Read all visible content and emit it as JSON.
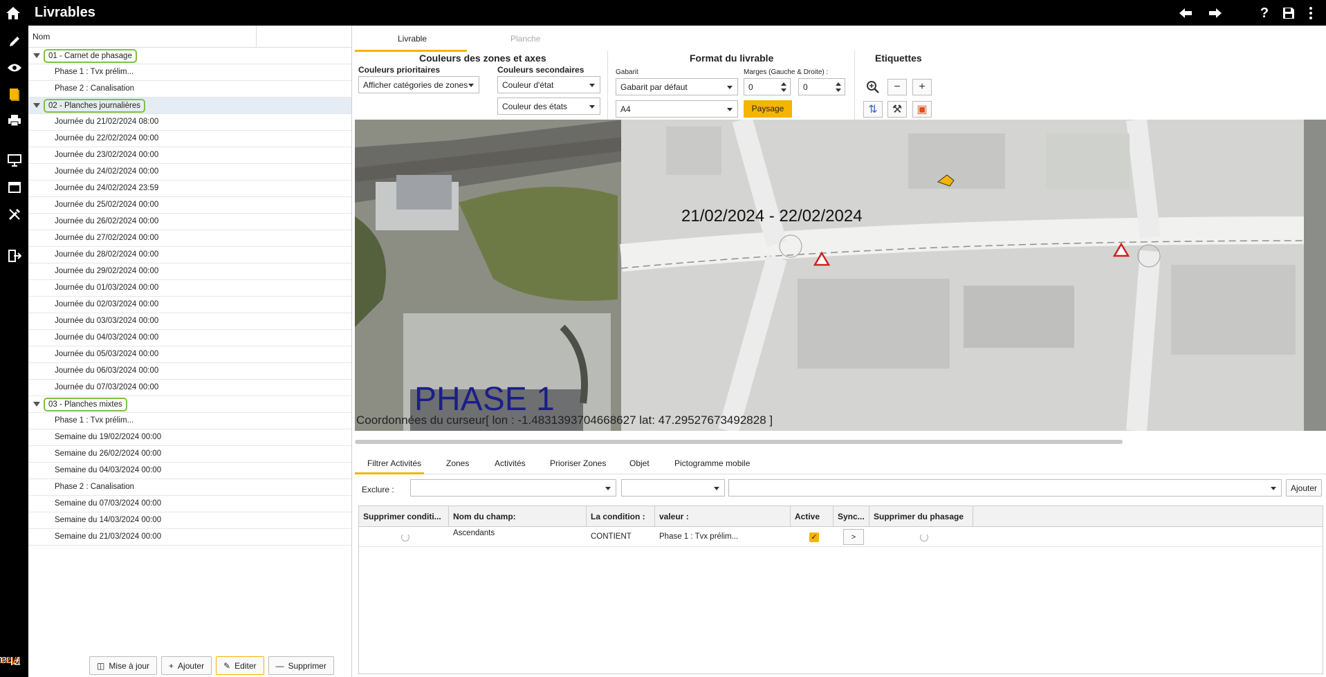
{
  "app": {
    "title": "Livrables",
    "brand": {
      "phase": "Phase",
      "manager": "Manager",
      "version": "7"
    }
  },
  "tree": {
    "header": "Nom",
    "groups": [
      {
        "label": "01 - Carnet de phasage",
        "children": [
          "Phase 1 : Tvx prélim...",
          "Phase 2 : Canalisation"
        ]
      },
      {
        "label": "02 - Planches journalières",
        "children": [
          "Journée du 21/02/2024 08:00",
          "Journée du 22/02/2024 00:00",
          "Journée du 23/02/2024 00:00",
          "Journée du 24/02/2024 00:00",
          "Journée du 24/02/2024 23:59",
          "Journée du 25/02/2024 00:00",
          "Journée du 26/02/2024 00:00",
          "Journée du 27/02/2024 00:00",
          "Journée du 28/02/2024 00:00",
          "Journée du 29/02/2024 00:00",
          "Journée du 01/03/2024 00:00",
          "Journée du 02/03/2024 00:00",
          "Journée du 03/03/2024 00:00",
          "Journée du 04/03/2024 00:00",
          "Journée du 05/03/2024 00:00",
          "Journée du 06/03/2024 00:00",
          "Journée du 07/03/2024 00:00"
        ]
      },
      {
        "label": "03 - Planches mixtes",
        "children": [
          "Phase 1 : Tvx prélim...",
          "Semaine du 19/02/2024 00:00",
          "Semaine du 26/02/2024 00:00",
          "Semaine du 04/03/2024 00:00",
          "Phase 2 : Canalisation",
          "Semaine du 07/03/2024 00:00",
          "Semaine du 14/03/2024 00:00",
          "Semaine du 21/03/2024 00:00"
        ]
      }
    ],
    "buttons": {
      "update": "Mise à jour",
      "add": "Ajouter",
      "edit": "Editer",
      "delete": "Supprimer"
    }
  },
  "tabs": {
    "livrable": "Livrable",
    "planche": "Planche"
  },
  "toolbar": {
    "zones": {
      "title": "Couleurs des zones et axes",
      "primary_label": "Couleurs prioritaires",
      "primary_value": "Afficher catégories de zones",
      "secondary_label": "Couleurs secondaires",
      "secondary_value_1": "Couleur d'état",
      "secondary_value_2": "Couleur des états"
    },
    "format": {
      "title": "Format du livrable",
      "gabarit_label": "Gabarit",
      "gabarit_value": "Gabarit par défaut",
      "margins_label": "Marges (Gauche & Droite) :",
      "margin_left": "0",
      "margin_right": "0",
      "paper": "A4",
      "orientation": "Paysage"
    },
    "labels": {
      "title": "Etiquettes"
    }
  },
  "map": {
    "date_range": "21/02/2024  - 22/02/2024",
    "phase": "PHASE 1",
    "coords": "Coordonnées du curseur[ lon : -1.4831393704668627  lat: 47.29527673492828 ]"
  },
  "bottom": {
    "tabs": [
      "Filtrer Activités",
      "Zones",
      "Activités",
      "Prioriser Zones",
      "Objet",
      "Pictogramme mobile"
    ],
    "exclude_label": "Exclure :",
    "add_button": "Ajouter",
    "columns": {
      "delete_cond": "Supprimer conditi...",
      "field": "Nom du champ:",
      "condition": "La condition :",
      "value": "valeur :",
      "active": "Active",
      "sync": "Sync...",
      "delete_phasing": "Supprimer du phasage"
    },
    "rows": [
      {
        "field": "Ascendants",
        "condition": "CONTIENT",
        "value": "Phase 1 : Tvx prélim...",
        "sync": ">"
      }
    ]
  },
  "colors": {
    "accent": "#f5b400",
    "group_outline": "#7cc142",
    "brand_orange": "#f47a20",
    "phase_text": "#1a1f88"
  }
}
